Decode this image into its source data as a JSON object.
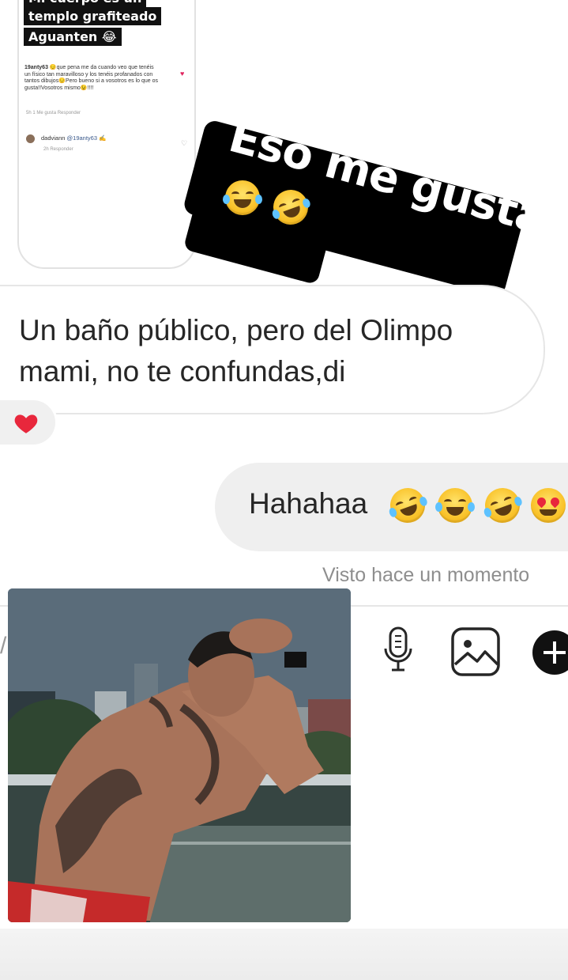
{
  "shared_post": {
    "caption_lines": [
      "Mi cuerpo es un",
      "templo grafiteado",
      "Aguanten 😂"
    ],
    "comment": {
      "user": "19anty63",
      "text": "😔que pena me da cuando veo que tenéis un físico tan maravilloso y los tenéis profanados con tantos dibujos😔Pero bueno si a vosotros es lo que os gusta!!Vosotros mismo😉!!!!",
      "meta": "5h   1 Me gusta   Responder"
    },
    "reply": {
      "user": "dadviann",
      "mention": "@19anty63 ✍",
      "meta": "2h   Responder"
    }
  },
  "sticker": {
    "text": "Eso me gusta"
  },
  "messages": {
    "received": "Un baño público, pero del Olimpo mami, no te confundas,di",
    "sent": "Hahahaa",
    "seen_status": "Visto hace un momento"
  },
  "composer": {
    "mic_icon": "microphone-icon",
    "gallery_icon": "gallery-icon",
    "plus_icon": "plus-circle-icon"
  },
  "colors": {
    "reaction_heart": "#e8273c",
    "sent_bubble": "#efefef",
    "sticker_bg": "#000000"
  }
}
